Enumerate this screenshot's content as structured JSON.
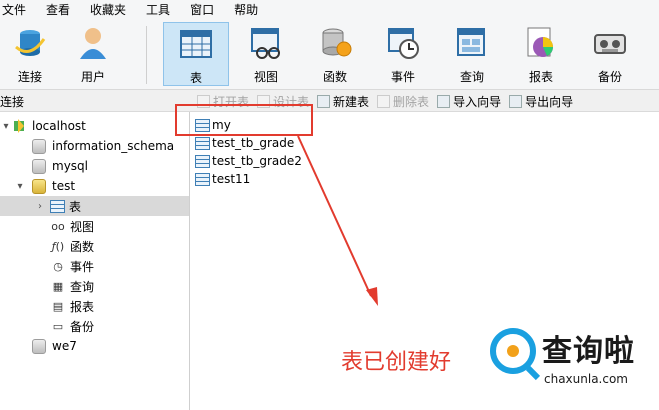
{
  "menu": [
    "文件",
    "查看",
    "收藏夹",
    "工具",
    "窗口",
    "帮助"
  ],
  "toolbar": {
    "buttons": [
      {
        "label": "连接",
        "icon": "connection-icon"
      },
      {
        "label": "用户",
        "icon": "user-icon"
      },
      {
        "label": "表",
        "icon": "table-icon",
        "active": true
      },
      {
        "label": "视图",
        "icon": "view-icon"
      },
      {
        "label": "函数",
        "icon": "function-icon"
      },
      {
        "label": "事件",
        "icon": "event-icon"
      },
      {
        "label": "查询",
        "icon": "query-icon"
      },
      {
        "label": "报表",
        "icon": "report-icon"
      },
      {
        "label": "备份",
        "icon": "backup-icon"
      }
    ]
  },
  "subbar": {
    "connections_label": "连接",
    "actions": [
      {
        "label": "打开表",
        "enabled": false
      },
      {
        "label": "设计表",
        "enabled": false
      },
      {
        "label": "新建表",
        "enabled": true
      },
      {
        "label": "删除表",
        "enabled": false
      },
      {
        "label": "导入向导",
        "enabled": true
      },
      {
        "label": "导出向导",
        "enabled": true
      }
    ]
  },
  "nav": {
    "connection": "localhost",
    "databases": [
      "information_schema",
      "mysql",
      "test",
      "we7"
    ],
    "test_children": [
      "表",
      "视图",
      "函数",
      "事件",
      "查询",
      "报表",
      "备份"
    ]
  },
  "content": {
    "tables": [
      "my",
      "test_tb_grade",
      "test_tb_grade2",
      "test11"
    ]
  },
  "annotation": "表已创建好",
  "watermark": {
    "brand": "查询啦",
    "url": "chaxunla.com"
  },
  "colors": {
    "annotation": "#e23b2e",
    "selection": "#d9d9d9",
    "active_tool": "#cde6f7"
  }
}
